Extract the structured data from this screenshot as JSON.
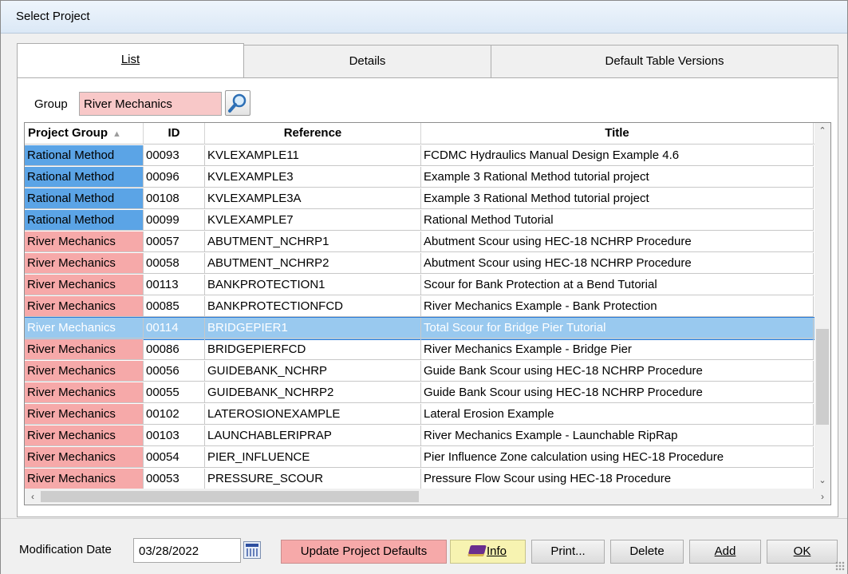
{
  "window": {
    "title": "Select Project"
  },
  "tabs": [
    {
      "label": "List",
      "active": true
    },
    {
      "label": "Details",
      "active": false
    },
    {
      "label": "Default Table Versions",
      "active": false
    }
  ],
  "group": {
    "label": "Group",
    "value": "River Mechanics",
    "search_icon": "magnifier-icon"
  },
  "grid": {
    "columns": [
      "Project Group",
      "ID",
      "Reference",
      "Title"
    ],
    "sort_column": "Project Group",
    "sort_direction": "ascending",
    "rows": [
      {
        "group": "Rational Method",
        "id": "00093",
        "reference": "KVLEXAMPLE11",
        "title": "FCDMC Hydraulics Manual Design Example 4.6"
      },
      {
        "group": "Rational Method",
        "id": "00096",
        "reference": "KVLEXAMPLE3",
        "title": "Example 3 Rational Method tutorial project"
      },
      {
        "group": "Rational Method",
        "id": "00108",
        "reference": "KVLEXAMPLE3A",
        "title": "Example 3 Rational Method tutorial project"
      },
      {
        "group": "Rational Method",
        "id": "00099",
        "reference": "KVLEXAMPLE7",
        "title": "Rational Method Tutorial"
      },
      {
        "group": "River Mechanics",
        "id": "00057",
        "reference": "ABUTMENT_NCHRP1",
        "title": "Abutment Scour using HEC-18 NCHRP Procedure"
      },
      {
        "group": "River Mechanics",
        "id": "00058",
        "reference": "ABUTMENT_NCHRP2",
        "title": "Abutment Scour using HEC-18 NCHRP Procedure"
      },
      {
        "group": "River Mechanics",
        "id": "00113",
        "reference": "BANKPROTECTION1",
        "title": "Scour for Bank Protection at a Bend Tutorial"
      },
      {
        "group": "River Mechanics",
        "id": "00085",
        "reference": "BANKPROTECTIONFCD",
        "title": "River Mechanics Example - Bank Protection"
      },
      {
        "group": "River Mechanics",
        "id": "00114",
        "reference": "BRIDGEPIER1",
        "title": "Total Scour for Bridge Pier Tutorial",
        "selected": true
      },
      {
        "group": "River Mechanics",
        "id": "00086",
        "reference": "BRIDGEPIERFCD",
        "title": "River Mechanics Example - Bridge Pier"
      },
      {
        "group": "River Mechanics",
        "id": "00056",
        "reference": "GUIDEBANK_NCHRP",
        "title": "Guide Bank Scour using HEC-18 NCHRP Procedure"
      },
      {
        "group": "River Mechanics",
        "id": "00055",
        "reference": "GUIDEBANK_NCHRP2",
        "title": "Guide Bank Scour using HEC-18 NCHRP Procedure"
      },
      {
        "group": "River Mechanics",
        "id": "00102",
        "reference": "LATEROSIONEXAMPLE",
        "title": "Lateral Erosion Example"
      },
      {
        "group": "River Mechanics",
        "id": "00103",
        "reference": "LAUNCHABLERIPRAP",
        "title": "River Mechanics Example - Launchable RipRap"
      },
      {
        "group": "River Mechanics",
        "id": "00054",
        "reference": "PIER_INFLUENCE",
        "title": "Pier Influence Zone calculation using HEC-18 Procedure"
      },
      {
        "group": "River Mechanics",
        "id": "00053",
        "reference": "PRESSURE_SCOUR",
        "title": "Pressure Flow Scour using HEC-18 Procedure"
      }
    ]
  },
  "footer": {
    "modification_label": "Modification Date",
    "modification_date": "03/28/2022",
    "calendar_icon": "calendar-icon",
    "buttons": {
      "update": "Update Project Defaults",
      "info": "Info",
      "print": "Print...",
      "delete": "Delete",
      "add": "Add",
      "ok": "OK"
    }
  },
  "colors": {
    "rational_method": "#5ba4e6",
    "river_mechanics": "#f6a9a9",
    "selection": "#99c9ef",
    "info_button": "#f7f3b1"
  }
}
